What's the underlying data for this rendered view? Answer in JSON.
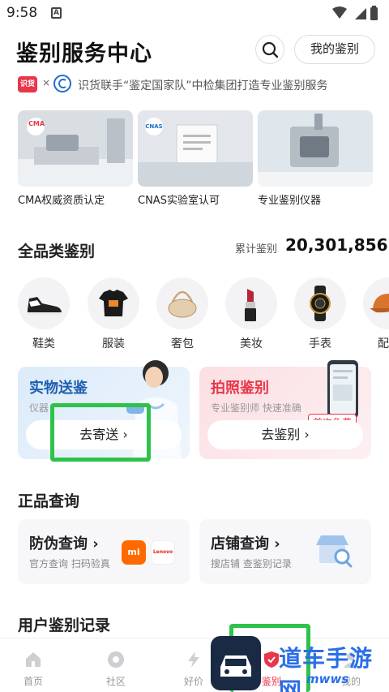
{
  "status_bar": {
    "time": "9:58",
    "a_icon": "A"
  },
  "header": {
    "title": "鉴别服务中心",
    "my_button": "我的鉴别"
  },
  "partner": {
    "shihuo_badge": "识货",
    "times": "×",
    "text": "识货联手“鉴定国家队”中检集团打造专业鉴别服务"
  },
  "certs": [
    {
      "label": "CMA权威资质认定",
      "mark": "CMA"
    },
    {
      "label": "CNAS实验室认可",
      "mark": "CNAS"
    },
    {
      "label": "专业鉴别仪器"
    }
  ],
  "categories_section": {
    "title": "全品类鉴别",
    "stat_label": "累计鉴别",
    "stat_value": "20,301,856",
    "items": [
      "鞋类",
      "服装",
      "奢包",
      "美妆",
      "手表",
      "配件"
    ]
  },
  "services": {
    "physical": {
      "title": "实物送鉴",
      "subtitle": "仪器",
      "button": "去寄送 ›"
    },
    "photo": {
      "title": "拍照鉴别",
      "subtitle": "专业鉴别师 快速准确",
      "button": "去鉴别 ›",
      "badge": "首次免费"
    }
  },
  "genuine_section": {
    "title": "正品查询",
    "anti_fake": {
      "title": "防伪查询 ›",
      "subtitle": "官方查询 扫码验真",
      "logo1": "mi",
      "logo2": "Lenovo"
    },
    "shop": {
      "title": "店铺查询 ›",
      "subtitle": "搜店铺 查鉴别记录"
    }
  },
  "records_section": {
    "title": "用户鉴别记录"
  },
  "bottom_nav": [
    {
      "label": "首页",
      "icon": "home-icon"
    },
    {
      "label": "社区",
      "icon": "community-icon"
    },
    {
      "label": "好价",
      "icon": "deal-icon"
    },
    {
      "label": "鉴别",
      "icon": "appraisal-icon"
    },
    {
      "label": "我的",
      "icon": "profile-icon"
    }
  ],
  "watermark": {
    "text": "道车手游网",
    "url": "mwws"
  },
  "colors": {
    "accent_red": "#e8364a",
    "green_highlight": "#2fc24a",
    "blue_card": "#e7f1fb",
    "pink_card": "#fde9eb"
  }
}
